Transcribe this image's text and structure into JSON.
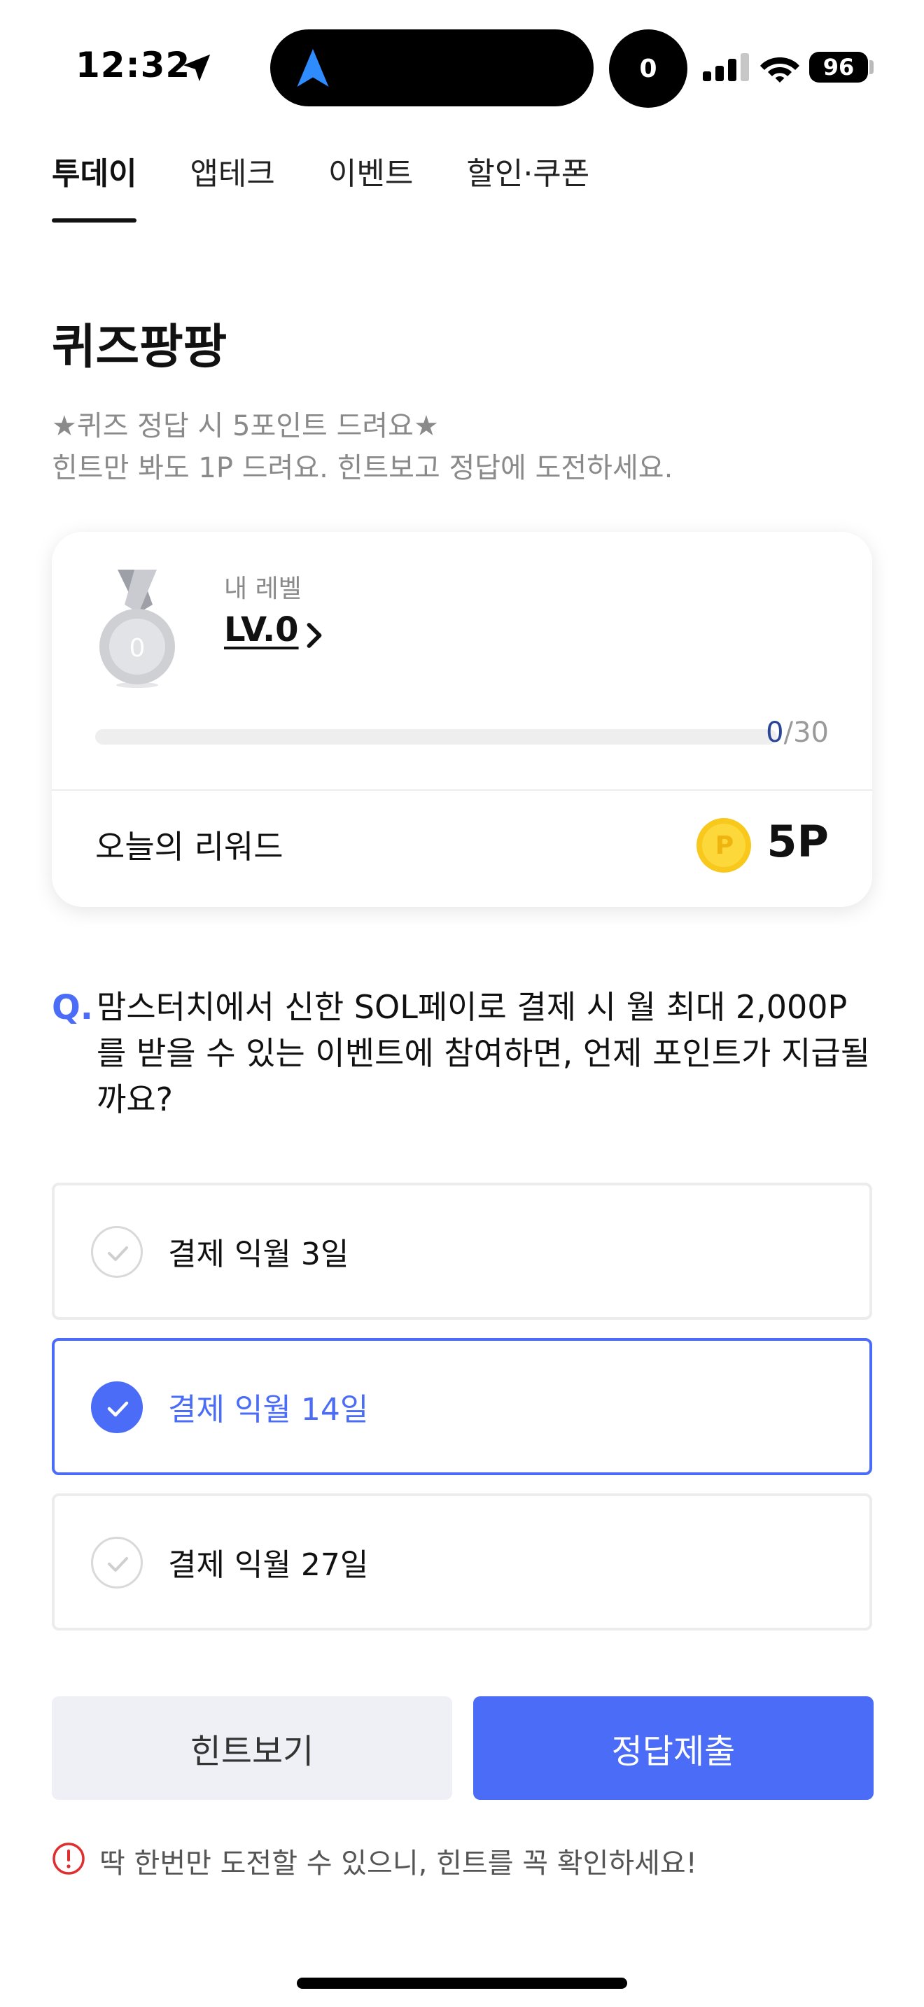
{
  "status_bar": {
    "time": "12:32",
    "notification_count": "0",
    "battery": "96"
  },
  "tabs": [
    {
      "label": "투데이",
      "active": true
    },
    {
      "label": "앱테크",
      "active": false
    },
    {
      "label": "이벤트",
      "active": false
    },
    {
      "label": "할인·쿠폰",
      "active": false
    }
  ],
  "quiz": {
    "title": "퀴즈팡팡",
    "subtitle_line1": "★퀴즈 정답 시 5포인트 드려요★",
    "subtitle_line2": "힌트만 봐도 1P 드려요. 힌트보고 정답에 도전하세요."
  },
  "level_card": {
    "medal_number": "0",
    "caption": "내 레벨",
    "level": "LV.0",
    "progress_current": "0",
    "progress_total": "/30",
    "progress_fraction": 0,
    "reward_label": "오늘의 리워드",
    "coin_symbol": "P",
    "reward_value": "5P"
  },
  "question": {
    "mark": "Q.",
    "text": "맘스터치에서 신한 SOL페이로 결제 시 월 최대 2,000P를 받을 수 있는 이벤트에 참여하면, 언제 포인트가 지급될까요?"
  },
  "options": [
    {
      "label": "결제 익월 3일",
      "selected": false
    },
    {
      "label": "결제 익월 14일",
      "selected": true
    },
    {
      "label": "결제 익월 27일",
      "selected": false
    }
  ],
  "buttons": {
    "hint": "힌트보기",
    "submit": "정답제출"
  },
  "warning": {
    "text": "딱 한번만 도전할 수 있으니, 힌트를 꼭 확인하세요!"
  },
  "colors": {
    "accent": "#4a6cf7",
    "muted_text": "#8a8a8a",
    "warning_red": "#e02d2d",
    "coin_gold": "#f8c81c"
  }
}
